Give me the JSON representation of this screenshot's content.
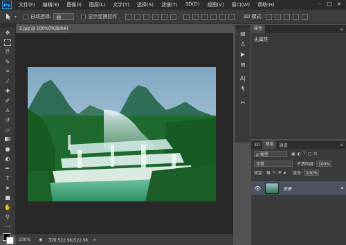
{
  "app": {
    "logo": "Ps"
  },
  "menu": [
    "文件(F)",
    "编辑(E)",
    "图像(I)",
    "图层(L)",
    "文字(Y)",
    "选择(S)",
    "滤镜(T)",
    "3D(D)",
    "视图(V)",
    "窗口(W)",
    "帮助(H)"
  ],
  "window_controls": [
    "–",
    "□",
    "×"
  ],
  "options": {
    "auto_select_label": "自动选择:",
    "auto_select_value": "组",
    "show_transform_label": "显示变换控件",
    "mode_3d_label": "3D 模式:"
  },
  "document": {
    "tab_label": "2.jpg @ 100%(RGB/8#)"
  },
  "status": {
    "zoom": "100%",
    "doc_info": "文档:522.9K/522.9K"
  },
  "properties": {
    "tab_label": "属性",
    "content": "无属性"
  },
  "layers": {
    "tabs": [
      "3D",
      "图层",
      "通道"
    ],
    "filter_kind": "ρ 类型",
    "blend_mode": "正常",
    "opacity_label": "不透明度:",
    "opacity_value": "100%",
    "lock_label": "锁定:",
    "fill_label": "填充:",
    "fill_value": "100%",
    "items": [
      {
        "name": "背景"
      }
    ]
  }
}
